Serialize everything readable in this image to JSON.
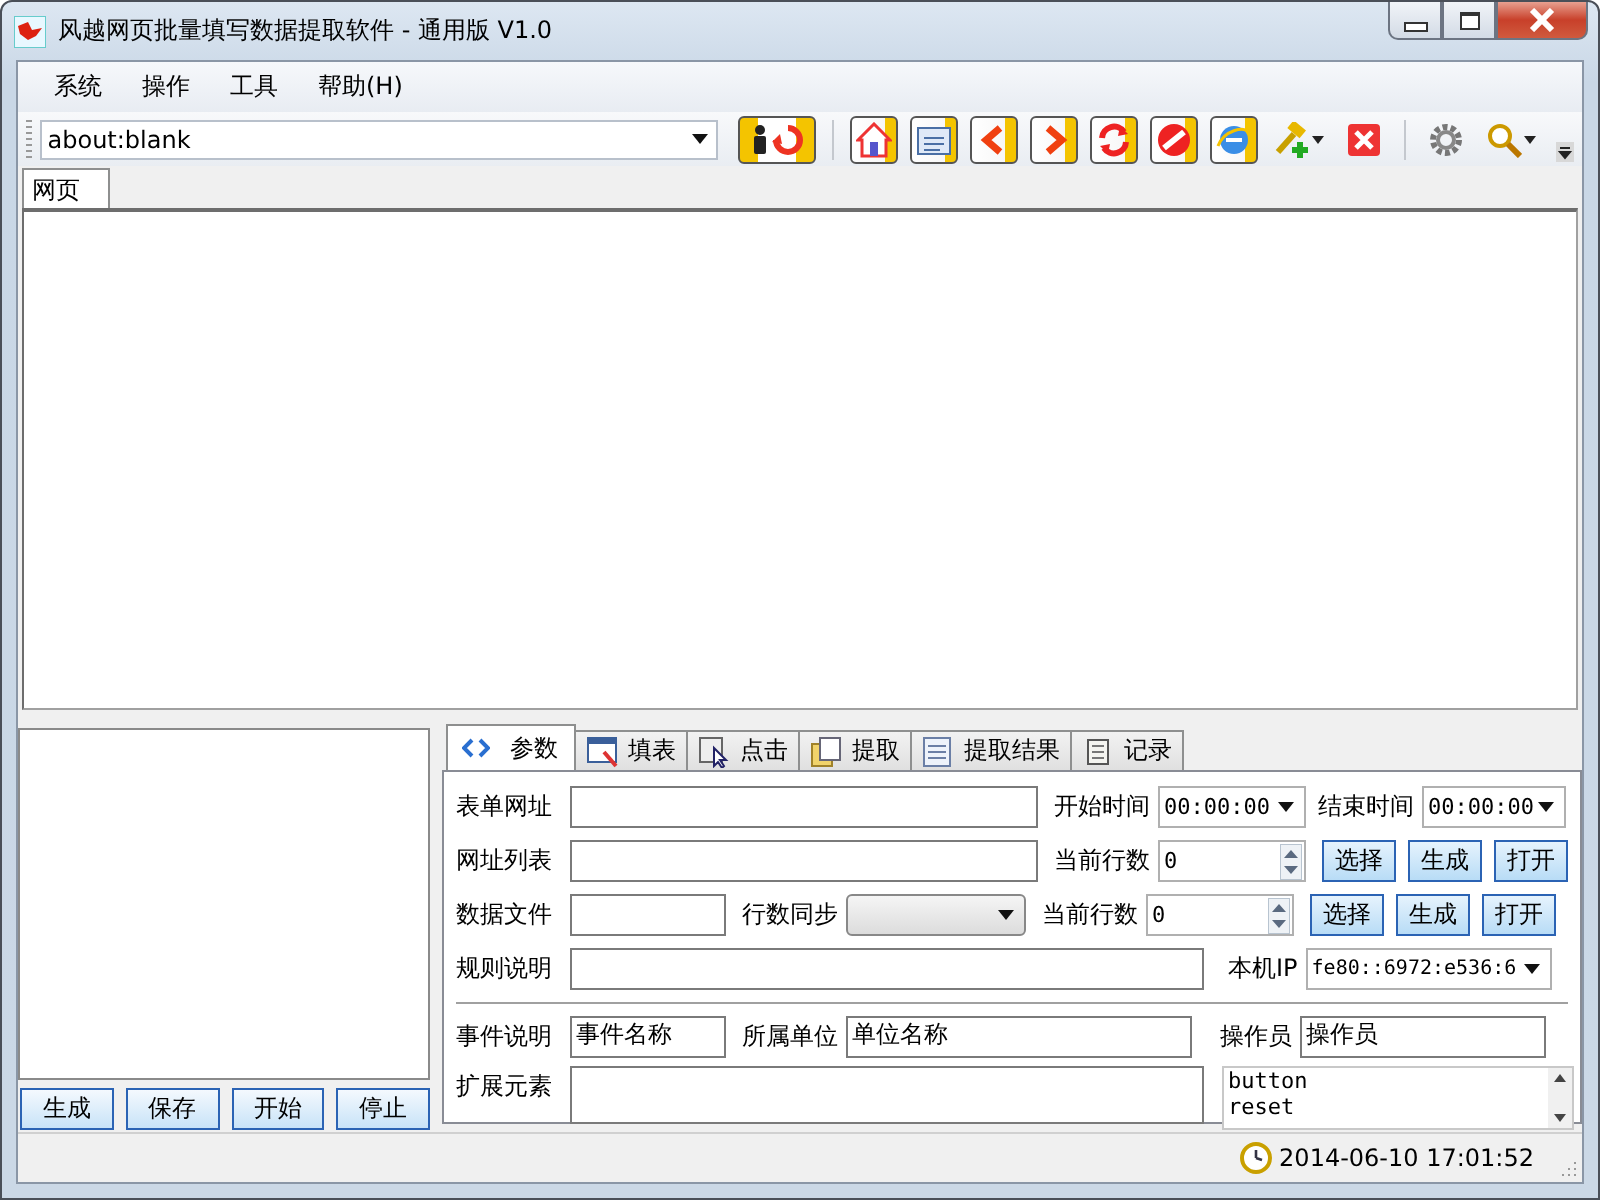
{
  "window": {
    "title": "风越网页批量填写数据提取软件 - 通用版 V1.0"
  },
  "menu": [
    "系统",
    "操作",
    "工具",
    "帮助(H)"
  ],
  "address": {
    "value": "about:blank"
  },
  "toolbar": [
    {
      "kind": "user-refresh"
    },
    {
      "kind": "separator"
    },
    {
      "kind": "home"
    },
    {
      "kind": "folder"
    },
    {
      "kind": "back"
    },
    {
      "kind": "forward"
    },
    {
      "kind": "reload"
    },
    {
      "kind": "stop"
    },
    {
      "kind": "browser"
    },
    {
      "kind": "hammer",
      "dropdown": true
    },
    {
      "kind": "close"
    },
    {
      "kind": "separator"
    },
    {
      "kind": "gear"
    },
    {
      "kind": "search",
      "dropdown": true
    }
  ],
  "browser_tabs": [
    {
      "label": "网页",
      "selected": true
    }
  ],
  "panel_tabs": [
    {
      "kind": "code",
      "label": "参数",
      "selected": true
    },
    {
      "kind": "table",
      "label": "填表",
      "selected": false
    },
    {
      "kind": "cursor",
      "label": "点击",
      "selected": false
    },
    {
      "kind": "pages",
      "label": "提取",
      "selected": false
    },
    {
      "kind": "sheet",
      "label": "提取结果",
      "selected": false
    },
    {
      "kind": "scroll",
      "label": "记录",
      "selected": false
    }
  ],
  "form": {
    "form_url_label": "表单网址",
    "start_time": {
      "label": "开始时间",
      "value": "00:00:00"
    },
    "end_time": {
      "label": "结束时间",
      "value": "00:00:00"
    },
    "url_list_label": "网址列表",
    "row1_current": {
      "label": "当前行数",
      "value": "0"
    },
    "row1_buttons": [
      "选择",
      "生成",
      "打开"
    ],
    "data_file_label": "数据文件",
    "row_sync_label": "行数同步",
    "row2_current": {
      "label": "当前行数",
      "value": "0"
    },
    "row2_buttons": [
      "选择",
      "生成",
      "打开"
    ],
    "rule_label": "规则说明",
    "ip": {
      "label": "本机IP",
      "value": "fe80::6972:e536:6"
    },
    "event": {
      "label": "事件说明",
      "value": "事件名称"
    },
    "unit": {
      "label": "所属单位",
      "value": "单位名称"
    },
    "operator": {
      "label": "操作员",
      "value": "操作员"
    },
    "ext_label": "扩展元素",
    "ext_list": [
      "button",
      "reset"
    ]
  },
  "left_buttons": [
    "生成",
    "保存",
    "开始",
    "停止"
  ],
  "status_bar": {
    "time": "2014-06-10 17:01:52"
  }
}
